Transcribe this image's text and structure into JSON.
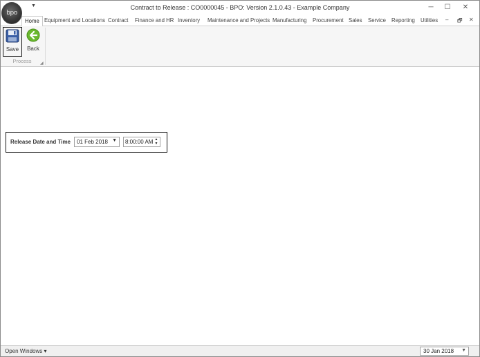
{
  "app": {
    "logo_text": "bpo",
    "window_title": "Contract to Release : CO0000045 - BPO: Version 2.1.0.43 - Example Company"
  },
  "window_controls": {
    "minimize": "─",
    "maximize": "☐",
    "close": "✕"
  },
  "ribbon": {
    "tabs": [
      {
        "label": "Home",
        "active": true
      },
      {
        "label": "Equipment and Locations"
      },
      {
        "label": "Contract"
      },
      {
        "label": "Finance and HR"
      },
      {
        "label": "Inventory"
      },
      {
        "label": "Maintenance and Projects"
      },
      {
        "label": "Manufacturing"
      },
      {
        "label": "Procurement"
      },
      {
        "label": "Sales"
      },
      {
        "label": "Service"
      },
      {
        "label": "Reporting"
      },
      {
        "label": "Utilities"
      }
    ],
    "tab_controls": {
      "minimize": "–",
      "restore": "🗗",
      "close": "✕"
    },
    "buttons": {
      "save": {
        "label": "Save",
        "icon": "save-disk-icon"
      },
      "back": {
        "label": "Back",
        "icon": "back-arrow-icon"
      }
    },
    "group_label": "Process",
    "colors": {
      "back_icon": "#6ab82e",
      "save_icon": "#3b5fa6"
    }
  },
  "form": {
    "release_label": "Release Date and Time",
    "date_value": "01 Feb 2018",
    "time_value": "8:00:00 AM"
  },
  "statusbar": {
    "open_windows": "Open Windows",
    "date_value": "30 Jan 2018"
  }
}
